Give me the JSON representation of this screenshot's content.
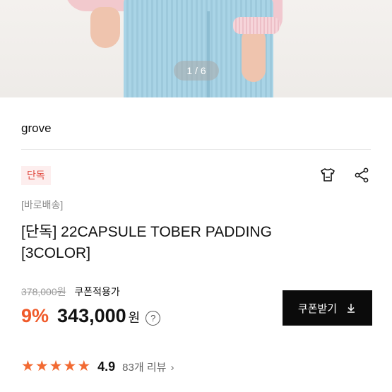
{
  "gallery": {
    "pager": "1 / 6"
  },
  "brand": {
    "name": "grove"
  },
  "badge": {
    "label": "단독"
  },
  "actions": {
    "fit_icon": "tshirt-icon",
    "share_icon": "share-icon"
  },
  "product": {
    "shipping_tag": "[바로배송]",
    "title": "[단독] 22CAPSULE TOBER PADDING [3COLOR]"
  },
  "price": {
    "original": "378,000원",
    "coupon_note": "쿠폰적용가",
    "discount": "9%",
    "final": "343,000",
    "currency": "원",
    "help_icon": "?"
  },
  "coupon_button": {
    "label": "쿠폰받기",
    "icon": "download-icon"
  },
  "rating": {
    "stars": 5,
    "score": "4.9",
    "reviews": "83개 리뷰",
    "chevron": "›"
  },
  "colors": {
    "accent": "#f05a2a",
    "badge_text": "#e0483e",
    "badge_bg": "#fdeeee",
    "button_bg": "#0b0b0b"
  }
}
